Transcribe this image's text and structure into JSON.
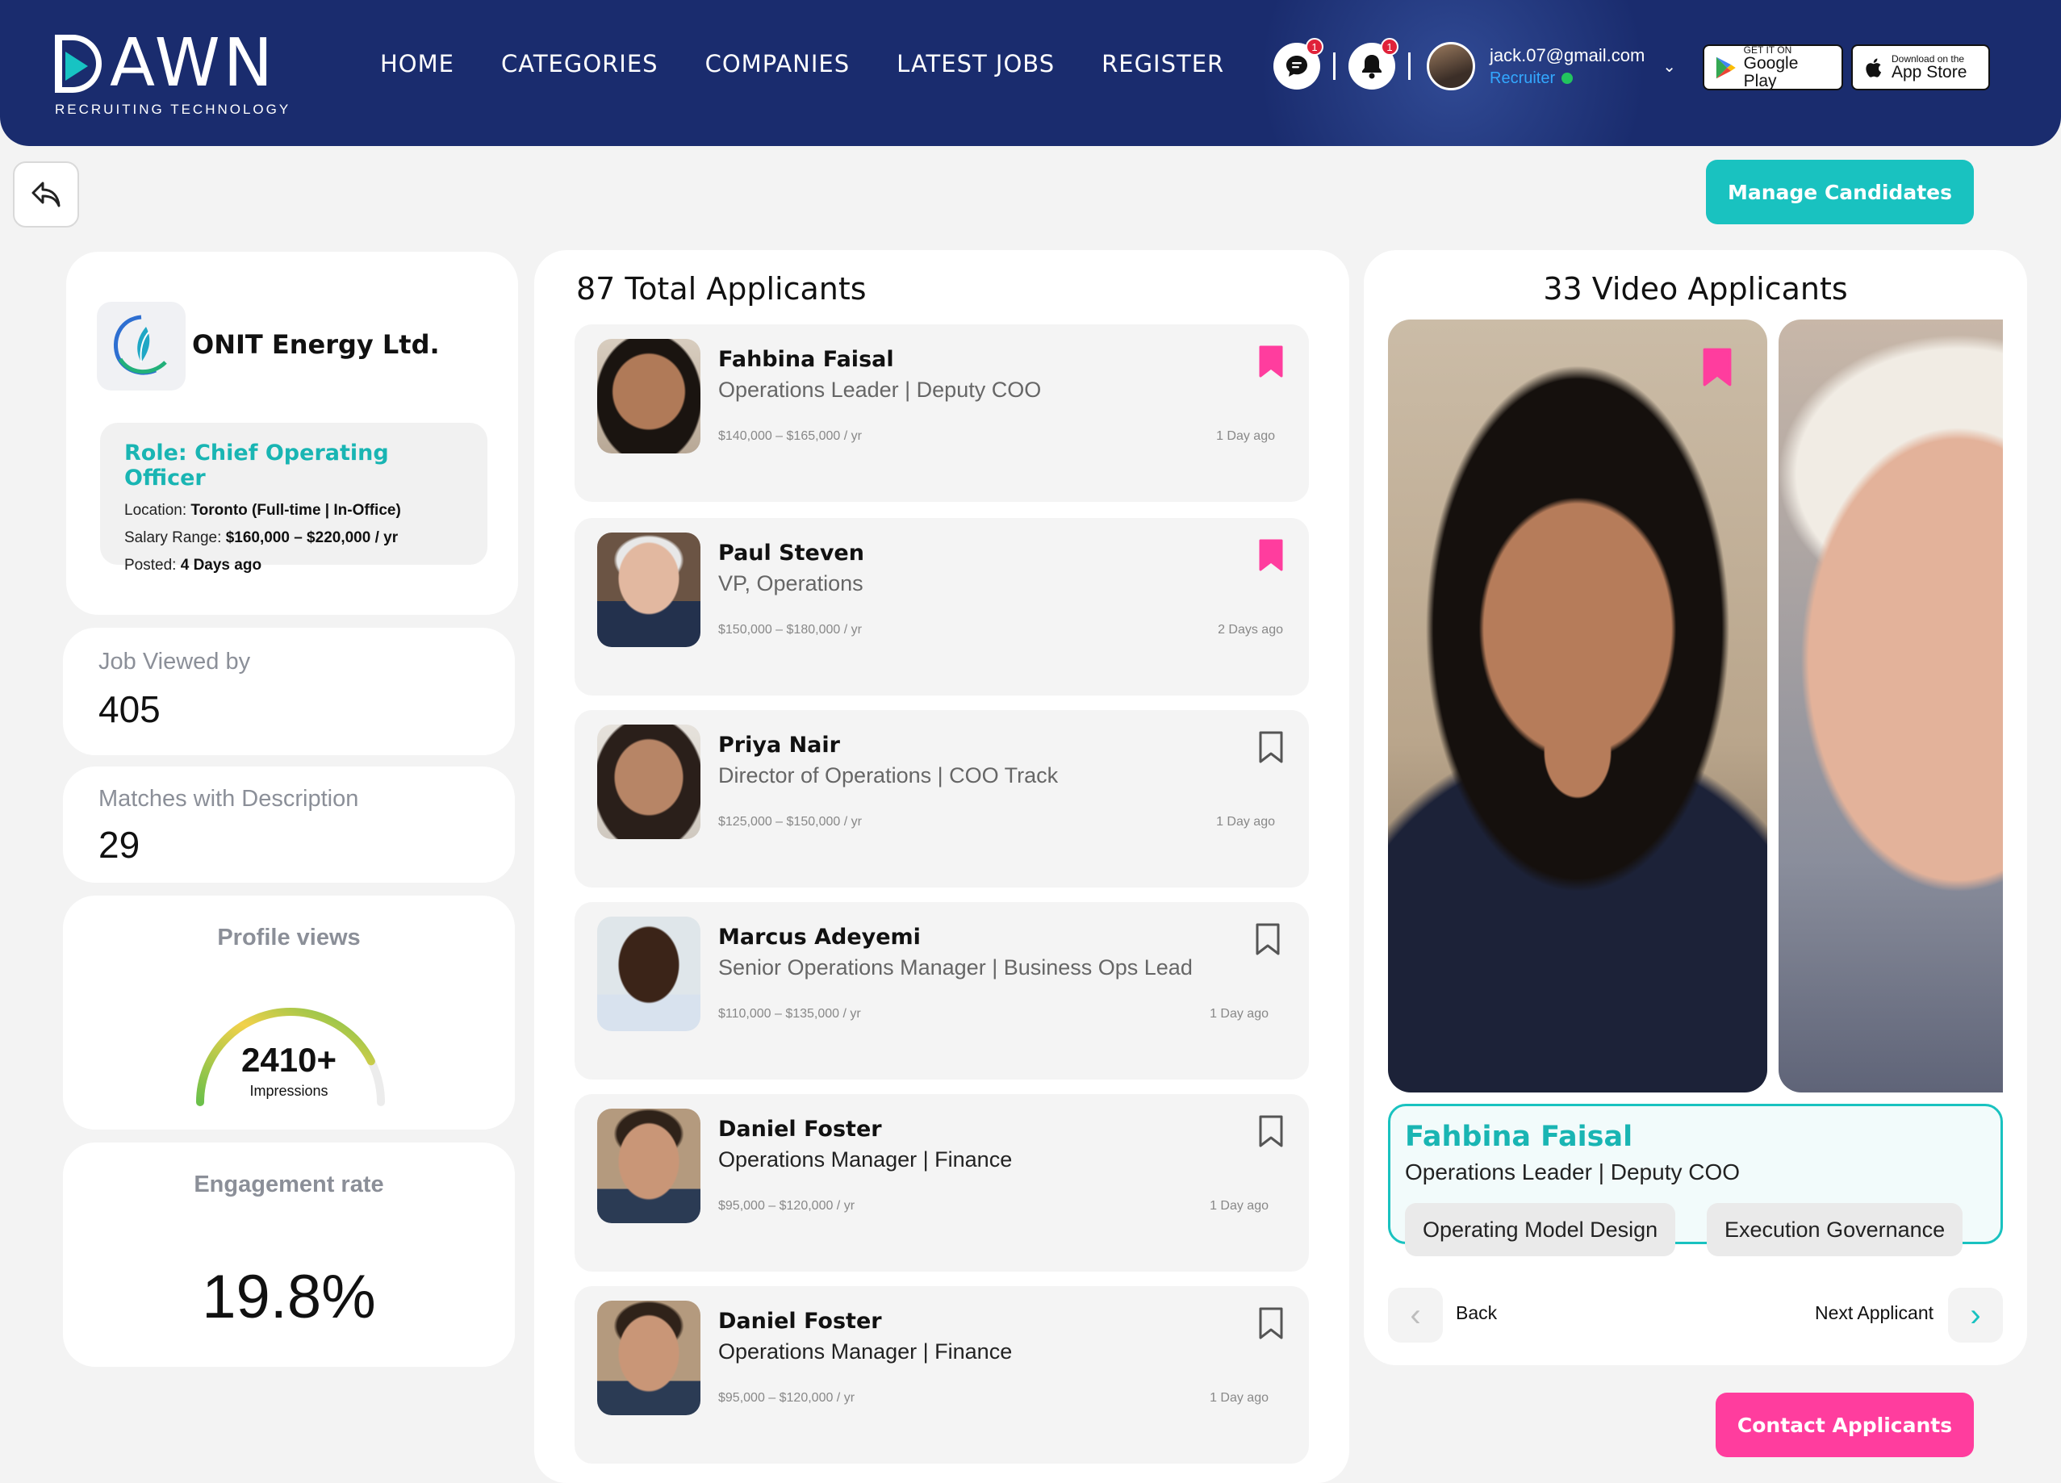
{
  "brand": {
    "name": "DAWN",
    "tagline": "RECRUITING TECHNOLOGY"
  },
  "nav": [
    "HOME",
    "CATEGORIES",
    "COMPANIES",
    "LATEST JOBS",
    "REGISTER"
  ],
  "header": {
    "messages_badge": "1",
    "notifications_badge": "1",
    "user_email": "jack.07@gmail.com",
    "user_role": "Recruiter",
    "google_small": "GET IT ON",
    "google_big": "Google Play",
    "apple_small": "Download on the",
    "apple_big": "App Store"
  },
  "actions": {
    "manage": "Manage Candidates",
    "contact": "Contact Applicants"
  },
  "company": {
    "name": "ONIT Energy Ltd.",
    "role": "Role: Chief Operating Officer",
    "location_label": "Location: ",
    "location": "Toronto (Full-time | In-Office)",
    "salary_label": "Salary Range: ",
    "salary": "$160,000 – $220,000 / yr",
    "posted_label": "Posted: ",
    "posted": "4 Days ago"
  },
  "stats": {
    "viewed_label": "Job Viewed by",
    "viewed": "405",
    "matches_label": "Matches with Description",
    "matches": "29",
    "profile_label": "Profile views",
    "profile_value": "2410+",
    "profile_sub": "Impressions",
    "profile_fill": 0.85,
    "engagement_label": "Engagement rate",
    "engagement": "19.8%"
  },
  "applicants": {
    "title": "87 Total Applicants",
    "items": [
      {
        "name": "Fahbina Faisal",
        "title": "Operations Leader | Deputy COO",
        "salary": "$140,000 – $165,000 / yr",
        "ago": "1 Day ago",
        "saved": true
      },
      {
        "name": "Paul Steven",
        "title": "VP, Operations",
        "salary": "$150,000 – $180,000 / yr",
        "ago": "2 Days ago",
        "saved": true
      },
      {
        "name": "Priya Nair",
        "title": "Director of Operations | COO Track",
        "salary": "$125,000 – $150,000 / yr",
        "ago": "1 Day ago",
        "saved": false
      },
      {
        "name": "Marcus Adeyemi",
        "title": "Senior Operations Manager | Business Ops Lead",
        "salary": "$110,000 – $135,000 / yr",
        "ago": "1 Day ago",
        "saved": false
      },
      {
        "name": "Daniel Foster",
        "title": "Operations Manager | Finance",
        "salary": "$95,000 – $120,000 / yr",
        "ago": "1 Day ago",
        "saved": false
      },
      {
        "name": "Daniel Foster",
        "title": "Operations Manager | Finance",
        "salary": "$95,000 – $120,000 / yr",
        "ago": "1 Day ago",
        "saved": false
      }
    ]
  },
  "video": {
    "title": "33 Video Applicants",
    "current_name": "Fahbina Faisal",
    "current_title": "Operations Leader | Deputy COO",
    "tags": [
      "Operating Model Design",
      "Execution Governance"
    ],
    "back": "Back",
    "next": "Next Applicant"
  },
  "colors": {
    "accent": "#19c2c0",
    "pink": "#ff3d9e",
    "navy": "#1a2c6e"
  }
}
